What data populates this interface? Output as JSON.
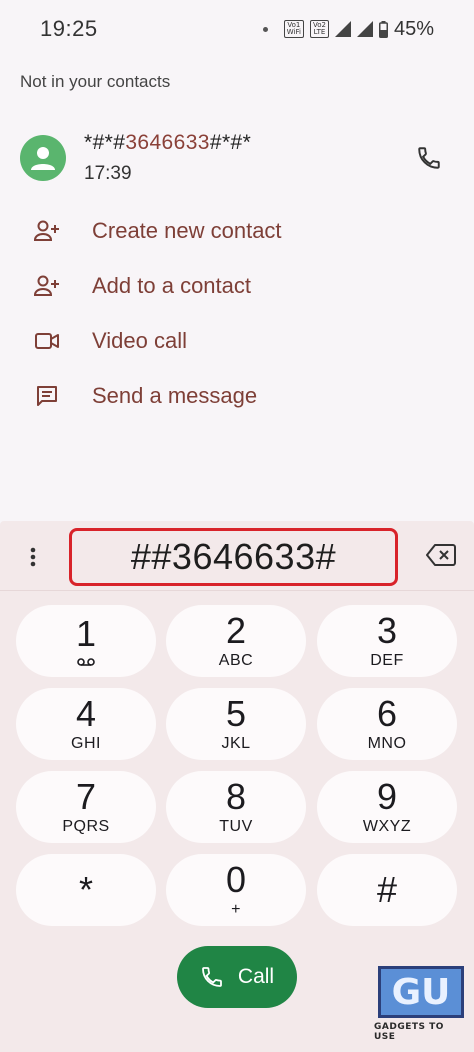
{
  "status_bar": {
    "time": "19:25",
    "badge_wifi": "Vo1 WiFi",
    "badge_lte": "Vo2 LTE",
    "battery_percent": "45%"
  },
  "recent": {
    "section_header": "Not in your contacts",
    "number_prefix": "*#*#",
    "number_highlight": "3646633",
    "number_suffix": "#*#*",
    "time": "17:39"
  },
  "actions": [
    {
      "label": "Create new contact",
      "icon": "add-person-icon"
    },
    {
      "label": "Add to a contact",
      "icon": "add-person-icon"
    },
    {
      "label": "Video call",
      "icon": "videocam-icon"
    },
    {
      "label": "Send a message",
      "icon": "message-icon"
    }
  ],
  "dialpad": {
    "digits": "##3646633#",
    "keys": [
      {
        "digit": "1",
        "letters": "",
        "voicemail": true
      },
      {
        "digit": "2",
        "letters": "ABC"
      },
      {
        "digit": "3",
        "letters": "DEF"
      },
      {
        "digit": "4",
        "letters": "GHI"
      },
      {
        "digit": "5",
        "letters": "JKL"
      },
      {
        "digit": "6",
        "letters": "MNO"
      },
      {
        "digit": "7",
        "letters": "PQRS"
      },
      {
        "digit": "8",
        "letters": "TUV"
      },
      {
        "digit": "9",
        "letters": "WXYZ"
      },
      {
        "digit": "*",
        "letters": ""
      },
      {
        "digit": "0",
        "letters": "+"
      },
      {
        "digit": "#",
        "letters": ""
      }
    ],
    "call_label": "Call"
  },
  "watermark": {
    "logo": "GU",
    "text": "GADGETS TO USE"
  },
  "colors": {
    "accent": "#7e3f37",
    "call_green": "#208545",
    "avatar_green": "#5ab56e",
    "highlight_red": "#d8232a"
  }
}
